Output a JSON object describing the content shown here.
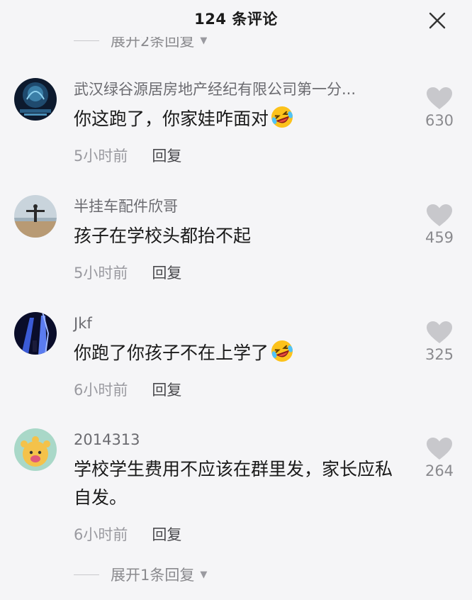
{
  "header": {
    "title": "124 条评论"
  },
  "top_expand": {
    "label": "展开2条回复"
  },
  "comments": [
    {
      "author": "武汉绿谷源居房地产经纪有限公司第一分...",
      "text": "你这跑了，你家娃咋面对",
      "emoji": "rolling-laughing-emoji",
      "time": "5小时前",
      "reply": "回复",
      "likes": "630"
    },
    {
      "author": "半挂车配件欣哥",
      "text": "孩子在学校头都抬不起",
      "time": "5小时前",
      "reply": "回复",
      "likes": "459"
    },
    {
      "author": "Jkf",
      "text": "你跑了你孩子不在上学了",
      "emoji": "rolling-laughing-emoji",
      "time": "6小时前",
      "reply": "回复",
      "likes": "325"
    },
    {
      "author": "2014313",
      "text": "学校学生费用不应该在群里发，家长应私自发。",
      "time": "6小时前",
      "reply": "回复",
      "likes": "264"
    }
  ],
  "bottom_expand": {
    "label": "展开1条回复"
  },
  "colors": {
    "background": "#f5f5f7",
    "text": "#1a1a1a",
    "muted": "#8a8a8e",
    "heart": "#c8c8cc"
  }
}
